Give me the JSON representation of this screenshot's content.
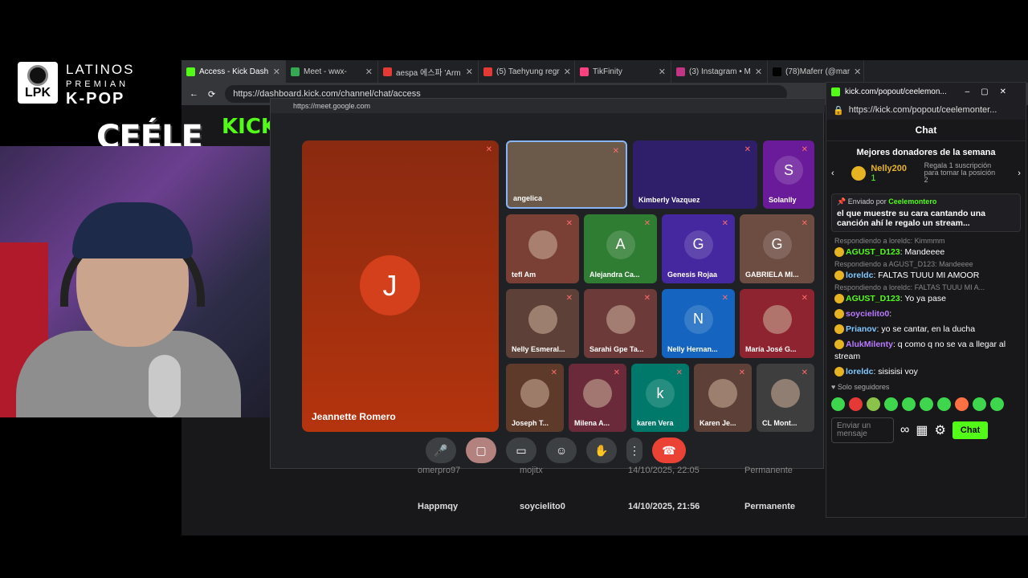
{
  "overlay": {
    "logo_lines": [
      "LATINOS",
      "PREMIAN",
      "K-POP"
    ],
    "logo_badge": "LPK",
    "streamer_tag": "CEÉLE"
  },
  "tabs": [
    {
      "label": "Access - Kick Dash",
      "color": "#53fc18",
      "active": true
    },
    {
      "label": "Meet - wwx-",
      "color": "#34a853",
      "active": false
    },
    {
      "label": "aespa 에스파 'Arm",
      "color": "#e53935",
      "active": false
    },
    {
      "label": "(5) Taehyung regr",
      "color": "#e53935",
      "active": false
    },
    {
      "label": "TikFinity",
      "color": "#ff4081",
      "active": false
    },
    {
      "label": "(3) Instagram • M",
      "color": "#c13584",
      "active": false
    },
    {
      "label": "(78)Maferr (@mar",
      "color": "#000000",
      "active": false
    }
  ],
  "address_url": "https://dashboard.kick.com/channel/chat/access",
  "kick_logo": "KICK",
  "meet": {
    "url": "https://meet.google.com",
    "speaker": {
      "initial": "J",
      "name": "Jeannette Romero"
    },
    "tiles": [
      {
        "name": "angelica",
        "initial": "",
        "bg": "#6b5a4a",
        "video": true
      },
      {
        "name": "Kimberly Vazquez",
        "initial": "",
        "bg": "#2f1f6b",
        "video": true
      },
      {
        "name": "Solanlly",
        "initial": "S",
        "bg": "#6a1b9a"
      },
      {
        "name": "tefl Am",
        "initial": "",
        "bg": "#7a4036"
      },
      {
        "name": "Alejandra Ca...",
        "initial": "A",
        "bg": "#2e7d32"
      },
      {
        "name": "Genesis Rojaa",
        "initial": "G",
        "bg": "#4527a0"
      },
      {
        "name": "GABRIELA MI...",
        "initial": "G",
        "bg": "#6d4c41"
      },
      {
        "name": "Nelly Esmeral...",
        "initial": "",
        "bg": "#5d4037"
      },
      {
        "name": "Sarahi Gpe Ta...",
        "initial": "",
        "bg": "#6d3a3a"
      },
      {
        "name": "Nelly Hernan...",
        "initial": "N",
        "bg": "#1565c0"
      },
      {
        "name": "María José G...",
        "initial": "",
        "bg": "#8e2430"
      },
      {
        "name": "Joseph T...",
        "initial": "",
        "bg": "#5d3a2a"
      },
      {
        "name": "Milena A...",
        "initial": "",
        "bg": "#6a2a3a"
      },
      {
        "name": "karen Vera",
        "initial": "k",
        "bg": "#00796b"
      },
      {
        "name": "Karen Je...",
        "initial": "",
        "bg": "#5d4037"
      },
      {
        "name": "CL Mont...",
        "initial": "",
        "bg": "#3e3e3e"
      }
    ]
  },
  "table": [
    {
      "user": "omerpro97",
      "by": "mojitx",
      "date": "14/10/2025, 22:05",
      "type": "Permanente"
    },
    {
      "user": "Happmqy",
      "by": "soycielito0",
      "date": "14/10/2025, 21:56",
      "type": "Permanente"
    }
  ],
  "popup": {
    "window_title": "kick.com/popout/ceelemon...",
    "url": "https://kick.com/popout/ceelemonter...",
    "chat_title": "Chat",
    "donors_title": "Mejores donadores de la semana",
    "top_donor": "Nelly200",
    "top_donor_count": "1",
    "gift_text": "Regala 1 suscripción para tomar la posición 2",
    "pinned_by": "Enviado por",
    "pinned_user": "Ceelemontero",
    "pinned_msg": "el que muestre su cara cantando una canción ahí le regalo un stream...",
    "messages": [
      {
        "reply": "Respondiendo a loreldc: Kimmmm",
        "user": "AGUST_D123",
        "color": "#53fc18",
        "text": "Mandeeee"
      },
      {
        "reply": "Respondiendo a AGUST_D123: Mandeeee",
        "user": "loreldc",
        "color": "#7ec8ff",
        "text": "FALTAS TUUU MI AMOOR"
      },
      {
        "reply": "Respondiendo a loreldc: FALTAS TUUU MI A...",
        "user": "AGUST_D123",
        "color": "#53fc18",
        "text": "Yo ya pase"
      },
      {
        "reply": "",
        "user": "soycielito0",
        "color": "#b97aff",
        "text": ""
      },
      {
        "reply": "",
        "user": "Prianov",
        "color": "#7ec8ff",
        "text": "yo se cantar, en la ducha"
      },
      {
        "reply": "",
        "user": "AlukMilenty",
        "color": "#b97aff",
        "text": "q como q no se va a llegar al stream"
      },
      {
        "reply": "",
        "user": "loreldc",
        "color": "#7ec8ff",
        "text": "sisisisi voy"
      }
    ],
    "followers_only": "Solo seguidores",
    "input_placeholder": "Enviar un mensaje",
    "chat_button": "Chat"
  }
}
